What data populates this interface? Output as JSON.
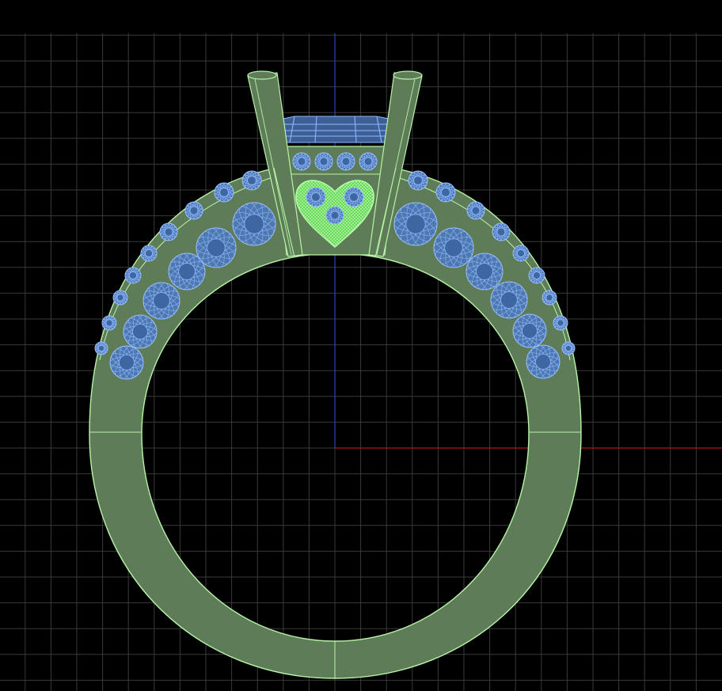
{
  "viewport": {
    "background": "#000000",
    "grid_color": "#3a3a3a",
    "grid_major_color": "#4a4a4a",
    "axis_x_color": "#b01818",
    "axis_y_color": "#2a48b8"
  },
  "model": {
    "metal_fill": "#5f7c58",
    "metal_edge": "#b6f5a6",
    "gem_fill": "#4d79b0",
    "gem_wire": "#8fb6ff",
    "heart_fill": "#6be05e",
    "heart_wire": "#b6ffa8",
    "icons": [
      "ring-shank",
      "prong",
      "pave-stone",
      "heart-setting",
      "center-stone"
    ]
  }
}
